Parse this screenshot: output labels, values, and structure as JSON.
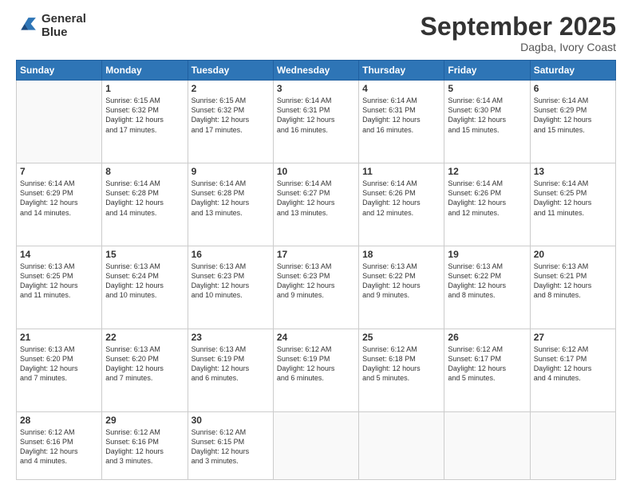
{
  "logo": {
    "line1": "General",
    "line2": "Blue"
  },
  "header": {
    "month": "September 2025",
    "location": "Dagba, Ivory Coast"
  },
  "weekdays": [
    "Sunday",
    "Monday",
    "Tuesday",
    "Wednesday",
    "Thursday",
    "Friday",
    "Saturday"
  ],
  "weeks": [
    [
      {
        "day": "",
        "info": ""
      },
      {
        "day": "1",
        "info": "Sunrise: 6:15 AM\nSunset: 6:32 PM\nDaylight: 12 hours\nand 17 minutes."
      },
      {
        "day": "2",
        "info": "Sunrise: 6:15 AM\nSunset: 6:32 PM\nDaylight: 12 hours\nand 17 minutes."
      },
      {
        "day": "3",
        "info": "Sunrise: 6:14 AM\nSunset: 6:31 PM\nDaylight: 12 hours\nand 16 minutes."
      },
      {
        "day": "4",
        "info": "Sunrise: 6:14 AM\nSunset: 6:31 PM\nDaylight: 12 hours\nand 16 minutes."
      },
      {
        "day": "5",
        "info": "Sunrise: 6:14 AM\nSunset: 6:30 PM\nDaylight: 12 hours\nand 15 minutes."
      },
      {
        "day": "6",
        "info": "Sunrise: 6:14 AM\nSunset: 6:29 PM\nDaylight: 12 hours\nand 15 minutes."
      }
    ],
    [
      {
        "day": "7",
        "info": "Sunrise: 6:14 AM\nSunset: 6:29 PM\nDaylight: 12 hours\nand 14 minutes."
      },
      {
        "day": "8",
        "info": "Sunrise: 6:14 AM\nSunset: 6:28 PM\nDaylight: 12 hours\nand 14 minutes."
      },
      {
        "day": "9",
        "info": "Sunrise: 6:14 AM\nSunset: 6:28 PM\nDaylight: 12 hours\nand 13 minutes."
      },
      {
        "day": "10",
        "info": "Sunrise: 6:14 AM\nSunset: 6:27 PM\nDaylight: 12 hours\nand 13 minutes."
      },
      {
        "day": "11",
        "info": "Sunrise: 6:14 AM\nSunset: 6:26 PM\nDaylight: 12 hours\nand 12 minutes."
      },
      {
        "day": "12",
        "info": "Sunrise: 6:14 AM\nSunset: 6:26 PM\nDaylight: 12 hours\nand 12 minutes."
      },
      {
        "day": "13",
        "info": "Sunrise: 6:14 AM\nSunset: 6:25 PM\nDaylight: 12 hours\nand 11 minutes."
      }
    ],
    [
      {
        "day": "14",
        "info": "Sunrise: 6:13 AM\nSunset: 6:25 PM\nDaylight: 12 hours\nand 11 minutes."
      },
      {
        "day": "15",
        "info": "Sunrise: 6:13 AM\nSunset: 6:24 PM\nDaylight: 12 hours\nand 10 minutes."
      },
      {
        "day": "16",
        "info": "Sunrise: 6:13 AM\nSunset: 6:23 PM\nDaylight: 12 hours\nand 10 minutes."
      },
      {
        "day": "17",
        "info": "Sunrise: 6:13 AM\nSunset: 6:23 PM\nDaylight: 12 hours\nand 9 minutes."
      },
      {
        "day": "18",
        "info": "Sunrise: 6:13 AM\nSunset: 6:22 PM\nDaylight: 12 hours\nand 9 minutes."
      },
      {
        "day": "19",
        "info": "Sunrise: 6:13 AM\nSunset: 6:22 PM\nDaylight: 12 hours\nand 8 minutes."
      },
      {
        "day": "20",
        "info": "Sunrise: 6:13 AM\nSunset: 6:21 PM\nDaylight: 12 hours\nand 8 minutes."
      }
    ],
    [
      {
        "day": "21",
        "info": "Sunrise: 6:13 AM\nSunset: 6:20 PM\nDaylight: 12 hours\nand 7 minutes."
      },
      {
        "day": "22",
        "info": "Sunrise: 6:13 AM\nSunset: 6:20 PM\nDaylight: 12 hours\nand 7 minutes."
      },
      {
        "day": "23",
        "info": "Sunrise: 6:13 AM\nSunset: 6:19 PM\nDaylight: 12 hours\nand 6 minutes."
      },
      {
        "day": "24",
        "info": "Sunrise: 6:12 AM\nSunset: 6:19 PM\nDaylight: 12 hours\nand 6 minutes."
      },
      {
        "day": "25",
        "info": "Sunrise: 6:12 AM\nSunset: 6:18 PM\nDaylight: 12 hours\nand 5 minutes."
      },
      {
        "day": "26",
        "info": "Sunrise: 6:12 AM\nSunset: 6:17 PM\nDaylight: 12 hours\nand 5 minutes."
      },
      {
        "day": "27",
        "info": "Sunrise: 6:12 AM\nSunset: 6:17 PM\nDaylight: 12 hours\nand 4 minutes."
      }
    ],
    [
      {
        "day": "28",
        "info": "Sunrise: 6:12 AM\nSunset: 6:16 PM\nDaylight: 12 hours\nand 4 minutes."
      },
      {
        "day": "29",
        "info": "Sunrise: 6:12 AM\nSunset: 6:16 PM\nDaylight: 12 hours\nand 3 minutes."
      },
      {
        "day": "30",
        "info": "Sunrise: 6:12 AM\nSunset: 6:15 PM\nDaylight: 12 hours\nand 3 minutes."
      },
      {
        "day": "",
        "info": ""
      },
      {
        "day": "",
        "info": ""
      },
      {
        "day": "",
        "info": ""
      },
      {
        "day": "",
        "info": ""
      }
    ]
  ]
}
